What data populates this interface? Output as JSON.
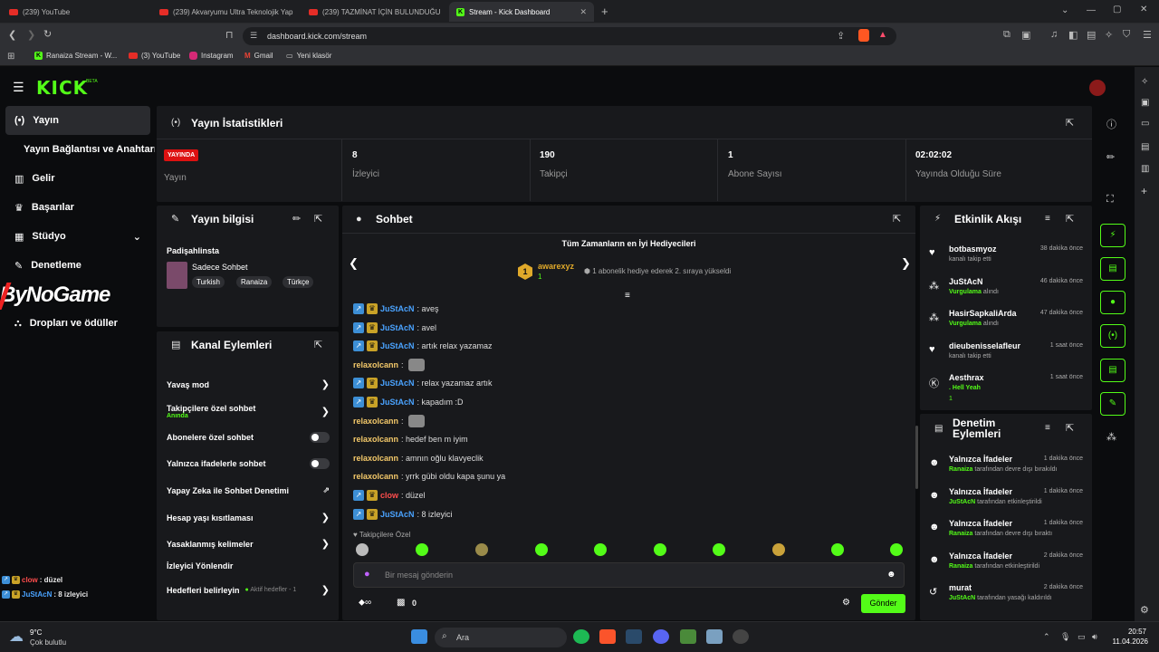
{
  "browser": {
    "tabs": [
      {
        "label": "(239) YouTube",
        "icon": "youtube-icon"
      },
      {
        "label": "(239) Akvaryumu Ultra Teknolojik Yap",
        "icon": "youtube-icon"
      },
      {
        "label": "(239) TAZMİNAT İÇİN BULUNDUĞU",
        "icon": "youtube-icon"
      },
      {
        "label": "Stream - Kick Dashboard",
        "icon": "kick-icon"
      }
    ],
    "url": "dashboard.kick.com/stream",
    "bookmarks": [
      "Ranaiza Stream - W...",
      "(3) YouTube",
      "Instagram",
      "Gmail",
      "Yeni klasör"
    ]
  },
  "header": {
    "logo": "KICK",
    "beta": "BETA"
  },
  "sidebar": {
    "items": [
      {
        "label": "Yayın",
        "icon": "broadcast-icon"
      },
      {
        "label": "Yayın Bağlantısı ve Anahtarı"
      },
      {
        "label": "Gelir",
        "icon": "chart-icon"
      },
      {
        "label": "Başarılar",
        "icon": "trophy-icon"
      },
      {
        "label": "Stüdyo",
        "icon": "studio-icon"
      },
      {
        "label": "Denetleme",
        "icon": "wrench-icon"
      },
      {
        "label": "Dropları ve ödüller",
        "icon": "gift-icon"
      }
    ],
    "overlay_text": "ByNoGame"
  },
  "stats": {
    "title": "Yayın İstatistikleri",
    "live_badge": "YAYINDA",
    "items": [
      {
        "value": "",
        "label": "Yayın"
      },
      {
        "value": "8",
        "label": "İzleyici"
      },
      {
        "value": "190",
        "label": "Takipçi"
      },
      {
        "value": "1",
        "label": "Abone Sayısı"
      },
      {
        "value": "02:02:02",
        "label": "Yayında Olduğu Süre"
      }
    ]
  },
  "stream_info": {
    "title": "Yayın bilgisi",
    "channel": "Padişahlinsta",
    "category": "Sadece Sohbet",
    "tags": [
      "Turkish",
      "Ranaiza",
      "Türkçe"
    ]
  },
  "channel_actions": {
    "title": "Kanal Eylemleri",
    "items": [
      {
        "label": "Yavaş mod",
        "control": "chevron"
      },
      {
        "label": "Takipçilere özel sohbet",
        "sub": "Anında",
        "control": "chevron"
      },
      {
        "label": "Abonelere özel sohbet",
        "control": "toggle"
      },
      {
        "label": "Yalnızca ifadelerle sohbet",
        "control": "toggle"
      },
      {
        "label": "Yapay Zeka ile Sohbet Denetimi",
        "control": "external"
      },
      {
        "label": "Hesap yaşı kısıtlaması",
        "control": "chevron"
      },
      {
        "label": "Yasaklanmış kelimeler",
        "control": "chevron"
      },
      {
        "label": "İzleyici Yönlendir",
        "control": "none"
      },
      {
        "label": "Hedefleri belirleyin",
        "extra": "Aktif hedefler - 1",
        "control": "chevron"
      }
    ]
  },
  "chat": {
    "title": "Sohbet",
    "gifters_title": "Tüm Zamanların en İyi Hediyecileri",
    "top_gifter": {
      "rank": "1",
      "name": "awarexyz",
      "count": "1"
    },
    "gifter_note": "1 abonelik hediye ederek 2. sıraya yükseldi",
    "messages": [
      {
        "user": "JuStAcN",
        "text": ": aveş",
        "badges": true,
        "style": "u1"
      },
      {
        "user": "JuStAcN",
        "text": ": avel",
        "badges": true,
        "style": "u1"
      },
      {
        "user": "JuStAcN",
        "text": ": artık relax yazamaz",
        "badges": true,
        "style": "u1"
      },
      {
        "user": "relaxolcann",
        "text": ":",
        "badges": false,
        "style": "u2",
        "emote": true
      },
      {
        "user": "JuStAcN",
        "text": ": relax yazamaz artık",
        "badges": true,
        "style": "u1"
      },
      {
        "user": "JuStAcN",
        "text": ": kapadım :D",
        "badges": true,
        "style": "u1"
      },
      {
        "user": "relaxolcann",
        "text": ":",
        "badges": false,
        "style": "u2",
        "emote": true
      },
      {
        "user": "relaxolcann",
        "text": ": hedef ben m    iyim",
        "badges": false,
        "style": "u2"
      },
      {
        "user": "relaxolcann",
        "text": ": amnın oğlu klavyeclik",
        "badges": false,
        "style": "u2"
      },
      {
        "user": "relaxolcann",
        "text": ": yrrk gübi oldu kapa şunu ya",
        "badges": false,
        "style": "u2"
      },
      {
        "user": "clow",
        "text": ": düzel",
        "badges": true,
        "style": "u3"
      },
      {
        "user": "JuStAcN",
        "text": ": 8 izleyici",
        "badges": true,
        "style": "u1"
      }
    ],
    "followers_only": "Takipçilere Özel",
    "input_placeholder": "Bir mesaj gönderin",
    "points": "0",
    "send": "Gönder"
  },
  "activity": {
    "title": "Etkinlik Akışı",
    "items": [
      {
        "name": "botbasmyoz",
        "time": "38 dakika önce",
        "sub": "kanalı takip etti",
        "icon": "heart-icon"
      },
      {
        "name": "JuStAcN",
        "time": "46 dakika önce",
        "sub_hl": "Vurgulama",
        "sub": " alındı",
        "icon": "points-icon"
      },
      {
        "name": "HasirSapkaliArda",
        "time": "47 dakika önce",
        "sub_hl": "Vurgulama",
        "sub": " alındı",
        "icon": "points-icon"
      },
      {
        "name": "dieubenisselafleur",
        "time": "1 saat önce",
        "sub": "kanalı takip etti",
        "icon": "heart-icon"
      },
      {
        "name": "Aesthrax",
        "time": "1 saat önce",
        "sub_hl": ". Hell Yeah",
        "sub": "",
        "count": "1",
        "icon": "kick-icon"
      }
    ]
  },
  "moderation": {
    "title": "Denetim Eylemleri",
    "items": [
      {
        "name": "Yalnızca İfadeler",
        "time": "1 dakika önce",
        "who": "Ranaiza",
        "sub": " tarafından devre dışı bırakıldı"
      },
      {
        "name": "Yalnızca İfadeler",
        "time": "1 dakika önce",
        "who": "JuStAcN",
        "sub": " tarafından etkinleştirildi"
      },
      {
        "name": "Yalnızca İfadeler",
        "time": "1 dakika önce",
        "who": "Ranaiza",
        "sub": " tarafından devre dışı bıraktı"
      },
      {
        "name": "Yalnızca İfadeler",
        "time": "2 dakika önce",
        "who": "Ranaiza",
        "sub": " tarafından etkinleştirildi"
      },
      {
        "name": "murat",
        "time": "2 dakika önce",
        "who": "JuStAcN",
        "sub": " tarafından yasağı kaldırıldı"
      }
    ]
  },
  "overlay_chat": [
    {
      "user": "clow",
      "text": ": düzel"
    },
    {
      "user": "JuStAcN",
      "text": ": 8 izleyici"
    }
  ],
  "taskbar": {
    "weather_temp": "9°C",
    "weather_text": "Çok bulutlu",
    "search": "Ara",
    "time": "20:57",
    "date": "11.04.2026"
  }
}
